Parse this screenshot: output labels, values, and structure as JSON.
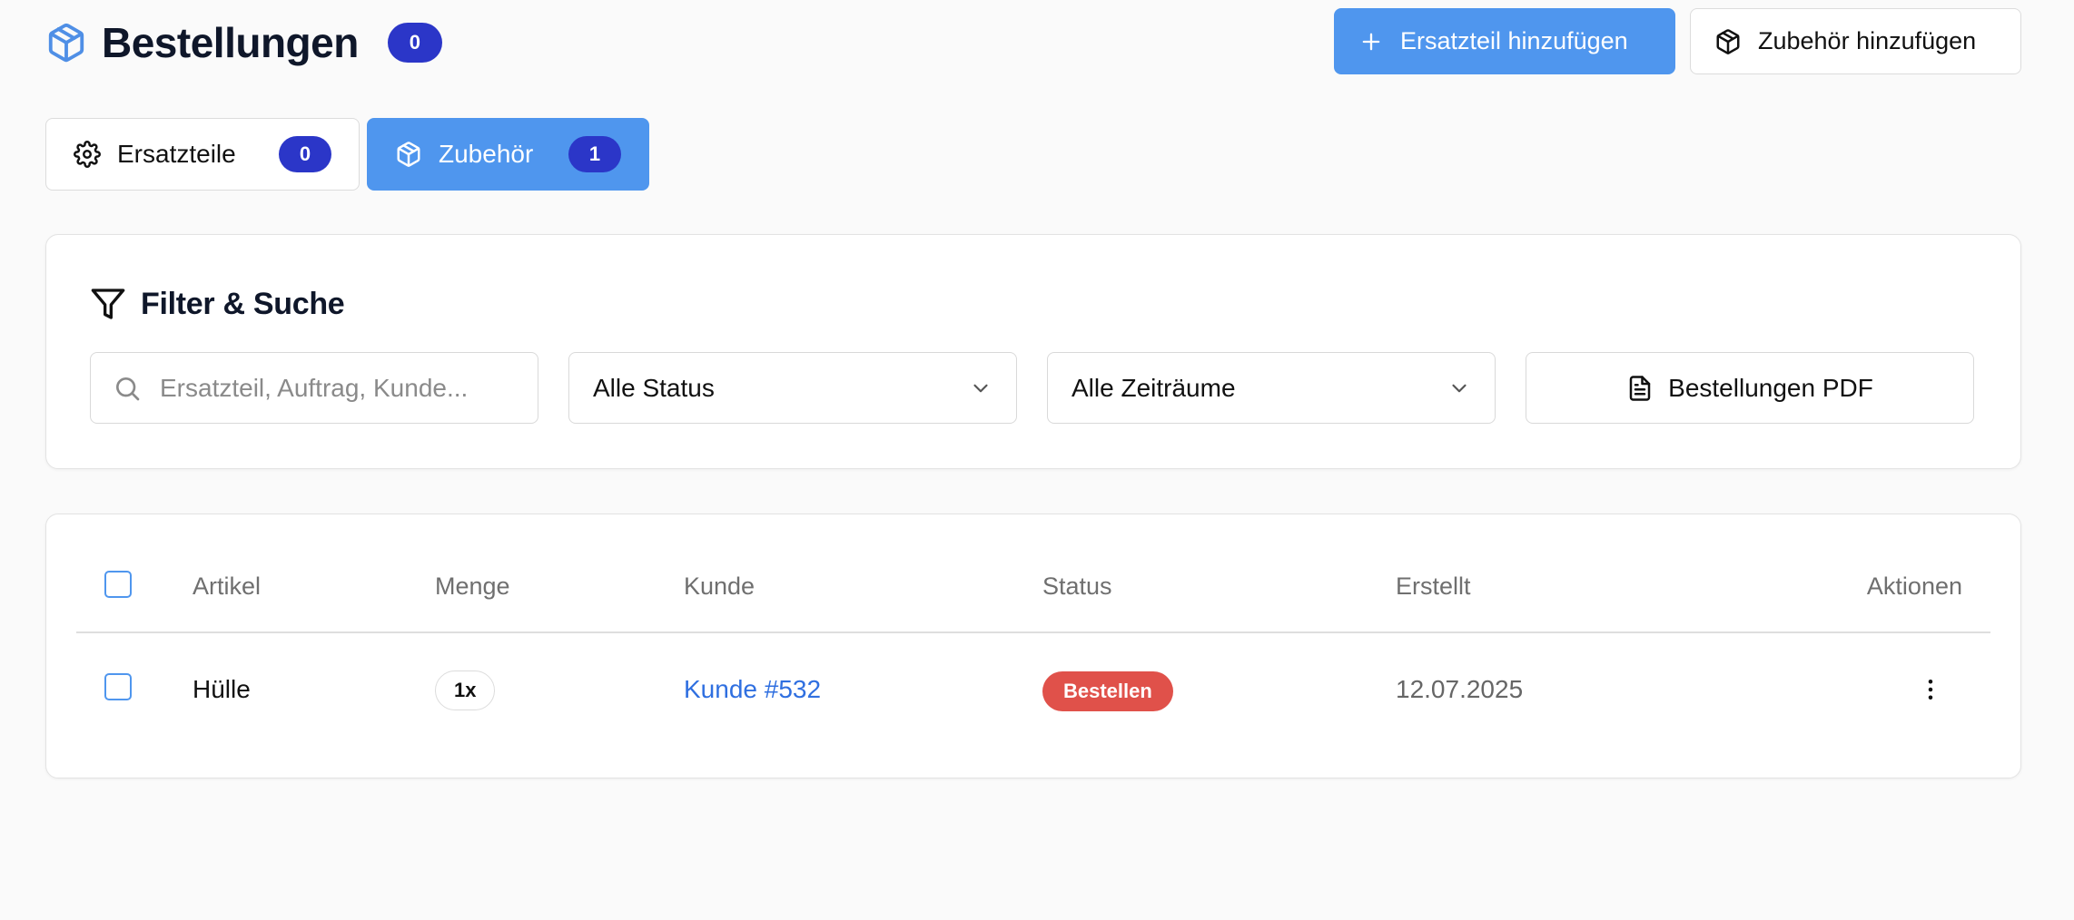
{
  "header": {
    "title": "Bestellungen",
    "count": "0",
    "icon": "package-icon",
    "add_part_label": "Ersatzteil hinzufügen",
    "add_accessory_label": "Zubehör hinzufügen"
  },
  "tabs": [
    {
      "label": "Ersatzteile",
      "count": "0",
      "icon": "gear-icon",
      "active": false
    },
    {
      "label": "Zubehör",
      "count": "1",
      "icon": "package-icon",
      "active": true
    }
  ],
  "filter": {
    "title": "Filter & Suche",
    "search_placeholder": "Ersatzteil, Auftrag, Kunde...",
    "search_value": "",
    "status_selected": "Alle Status",
    "period_selected": "Alle Zeiträume",
    "pdf_label": "Bestellungen PDF"
  },
  "table": {
    "headers": {
      "article": "Artikel",
      "quantity": "Menge",
      "customer": "Kunde",
      "status": "Status",
      "created": "Erstellt",
      "actions": "Aktionen"
    },
    "rows": [
      {
        "article": "Hülle",
        "quantity": "1x",
        "customer": "Kunde #532",
        "status": "Bestellen",
        "created": "12.07.2025"
      }
    ]
  },
  "colors": {
    "accent": "#4f96ee",
    "badge": "#2b36c8",
    "status_order": "#e0514a",
    "link": "#2f6fe0"
  }
}
